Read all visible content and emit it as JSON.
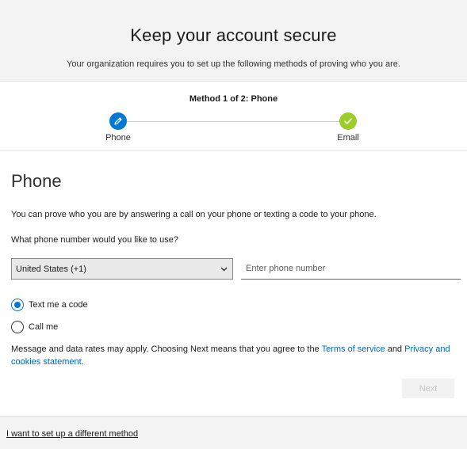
{
  "header": {
    "title": "Keep your account secure",
    "subtitle": "Your organization requires you to set up the following methods of proving who you are."
  },
  "progress": {
    "method_label": "Method 1 of 2: Phone",
    "steps": [
      {
        "label": "Phone",
        "icon": "pencil-icon",
        "color": "#0078d4",
        "state": "current"
      },
      {
        "label": "Email",
        "icon": "checkmark-icon",
        "color": "#9ccd2a",
        "state": "pending"
      }
    ]
  },
  "main": {
    "section_title": "Phone",
    "description": "You can prove who you are by answering a call on your phone or texting a code to your phone.",
    "question": "What phone number would you like to use?",
    "country_select": {
      "value": "United States (+1)"
    },
    "phone_input": {
      "value": "",
      "placeholder": "Enter phone number"
    },
    "options": [
      {
        "label": "Text me a code",
        "checked": true
      },
      {
        "label": "Call me",
        "checked": false
      }
    ],
    "legal": {
      "prefix": "Message and data rates may apply. Choosing Next means that you agree to the ",
      "terms_link": "Terms of service",
      "middle": " and ",
      "privacy_link": "Privacy and cookies statement",
      "suffix": "."
    },
    "next_button": "Next"
  },
  "footer": {
    "link": "I want to set up a different method"
  },
  "colors": {
    "accent": "#0078d4",
    "success": "#9ccd2a",
    "link": "#0067b8"
  }
}
